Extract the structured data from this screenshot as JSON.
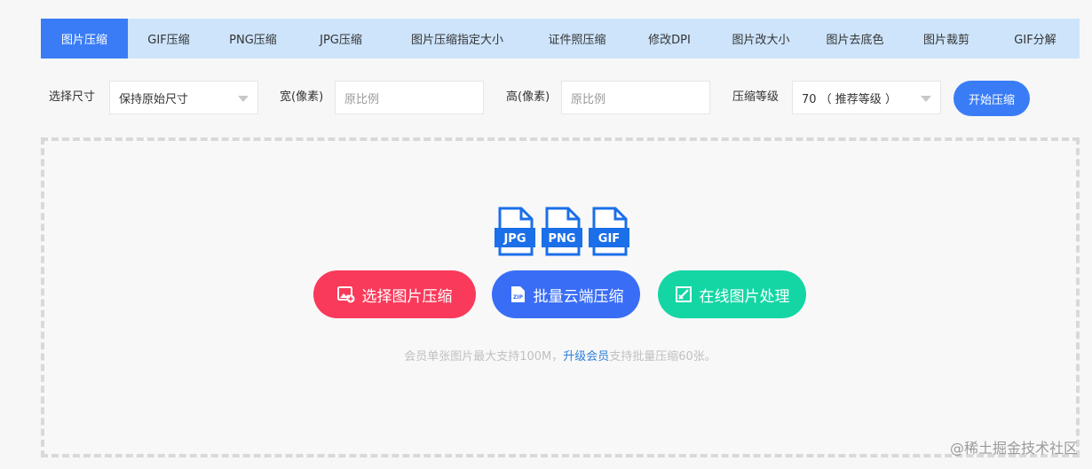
{
  "tabs": [
    {
      "label": "图片压缩",
      "active": true
    },
    {
      "label": "GIF压缩"
    },
    {
      "label": "PNG压缩"
    },
    {
      "label": "JPG压缩"
    },
    {
      "label": "图片压缩指定大小"
    },
    {
      "label": "证件照压缩"
    },
    {
      "label": "修改DPI"
    },
    {
      "label": "图片改大小"
    },
    {
      "label": "图片去底色"
    },
    {
      "label": "图片裁剪"
    },
    {
      "label": "GIF分解"
    }
  ],
  "options": {
    "size_label": "选择尺寸",
    "size_value": "保持原始尺寸",
    "width_label": "宽(像素)",
    "width_placeholder": "原比例",
    "height_label": "高(像素)",
    "height_placeholder": "原比例",
    "level_label": "压缩等级",
    "level_value": "70 （ 推荐等级 ）",
    "start_label": "开始压缩"
  },
  "dropzone": {
    "filetypes": [
      "JPG",
      "PNG",
      "GIF"
    ],
    "select_label": "选择图片压缩",
    "batch_label": "批量云端压缩",
    "online_label": "在线图片处理",
    "note_prefix": "会员单张图片最大支持100M，",
    "note_link": "升级会员",
    "note_suffix": "支持批量压缩60张。"
  },
  "watermark": "@稀土掘金技术社区",
  "colors": {
    "accent": "#3a7cf6",
    "tabbar_bg": "#cde4fb",
    "select_btn": "#f93a5a",
    "batch_btn": "#3a6df6",
    "online_btn": "#14d6a4",
    "link": "#2f7fd6"
  }
}
